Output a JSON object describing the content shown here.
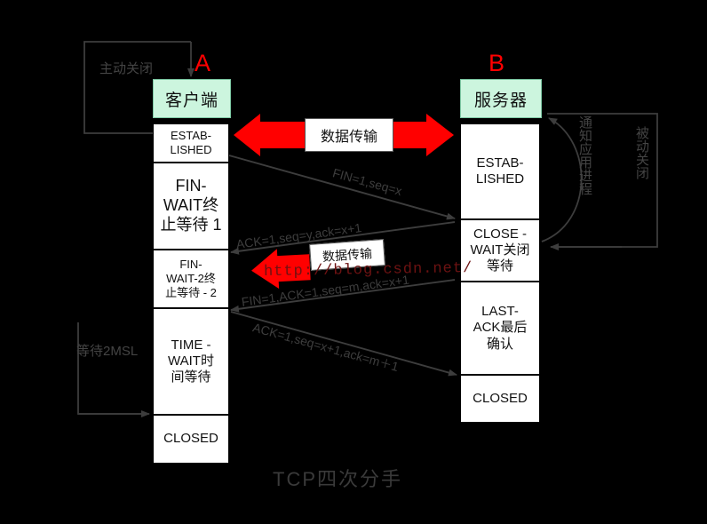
{
  "diagram": {
    "caption": "TCP四次分手",
    "watermark": "http://blog.csdn.net/",
    "background_color": "#000000",
    "accent_red": "#ff0000",
    "endpoint_fill": "#ccf5de",
    "state_fill": "#ffffff"
  },
  "client": {
    "letter": "A",
    "title": "客户端",
    "annotation": "主动关闭",
    "wait_annotation": "等待2MSL",
    "states": [
      {
        "line1": "ESTAB-",
        "line2": "LISHED",
        "line3": ""
      },
      {
        "line1": "FIN-",
        "line2": "WAIT终",
        "line3": "止等待 1"
      },
      {
        "line1": "FIN-",
        "line2": "WAIT-2终",
        "line3": "止等待 - 2"
      },
      {
        "line1": "TIME -",
        "line2": "WAIT时",
        "line3": "间等待"
      },
      {
        "line1": "CLOSED",
        "line2": "",
        "line3": ""
      }
    ]
  },
  "server": {
    "letter": "B",
    "title": "服务器",
    "annotation_passive": "被动关闭",
    "annotation_notify": "通知应用进程",
    "states": [
      {
        "line1": "ESTAB-",
        "line2": "LISHED",
        "line3": ""
      },
      {
        "line1": "CLOSE -",
        "line2": "WAIT关闭",
        "line3": "等待"
      },
      {
        "line1": "LAST-",
        "line2": "ACK最后",
        "line3": "确认"
      },
      {
        "line1": "CLOSED",
        "line2": "",
        "line3": ""
      }
    ]
  },
  "data_transfer": {
    "label_top": "数据传输",
    "label_mid": "数据传输"
  },
  "packets": [
    {
      "id": "fin1",
      "text": "FIN=1,seq=x",
      "direction": "client-to-server"
    },
    {
      "id": "ack1",
      "text": "ACK=1,seq=y,ack=x+1",
      "direction": "server-to-client"
    },
    {
      "id": "fin2",
      "text": "FIN=1,ACK=1,seq=m,ack=x+1",
      "direction": "server-to-client"
    },
    {
      "id": "ack2",
      "text": "ACK=1,seq=x+1,ack=m＋1",
      "direction": "client-to-server"
    }
  ]
}
